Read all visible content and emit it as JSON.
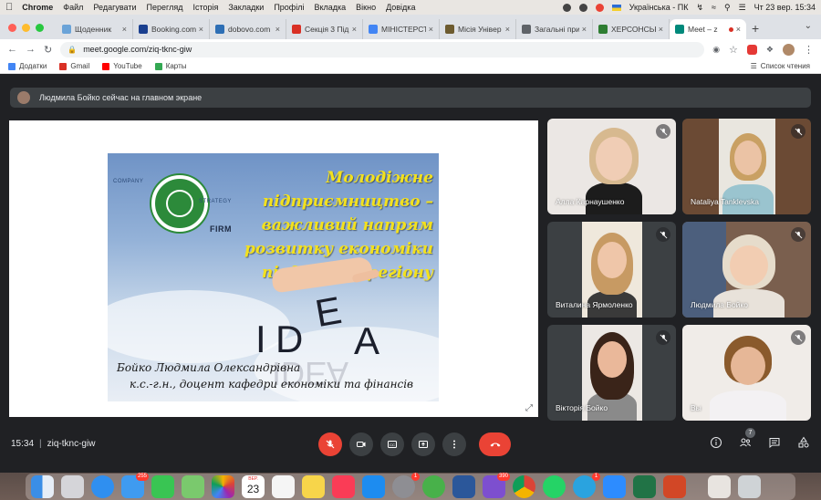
{
  "menubar": {
    "app": "Chrome",
    "menus": [
      "Файл",
      "Редагувати",
      "Перегляд",
      "Історія",
      "Закладки",
      "Профілі",
      "Вкладка",
      "Вікно",
      "Довідка"
    ],
    "keyboard_layout": "Українська - ПК",
    "datetime": "Чт 23 вер.  15:34"
  },
  "tabs": [
    {
      "title": "Щоденник",
      "color": "#6aa3d8"
    },
    {
      "title": "Booking.com",
      "color": "#1a3f8f"
    },
    {
      "title": "dobovo.com",
      "color": "#2e6fb5"
    },
    {
      "title": "Секція 3 Під",
      "color": "#d93025"
    },
    {
      "title": "МІНІСТЕРСТ",
      "color": "#4285f4"
    },
    {
      "title": "Місія Універ",
      "color": "#6d5b2f"
    },
    {
      "title": "Загальні при",
      "color": "#5f6368"
    },
    {
      "title": "ХЕРСОНСЬК",
      "color": "#2e7d32"
    },
    {
      "title": "Meet – z",
      "color": "#00897b"
    }
  ],
  "address": {
    "url": "meet.google.com/ziq-tknc-giw"
  },
  "bookmarks": {
    "items": [
      {
        "label": "Додатки",
        "color": "#4285f4"
      },
      {
        "label": "Gmail",
        "color": "#d93025"
      },
      {
        "label": "YouTube",
        "color": "#ff0000"
      },
      {
        "label": "Карты",
        "color": "#34a853"
      }
    ],
    "reading_list": "Список чтения"
  },
  "meet": {
    "presenting_text": "Людмила Бойко сейчас на главном экране",
    "slide": {
      "headline": "Молодіжне підприємництво – важливий напрям розвитку економіки південного регіону",
      "word_idea": "IDEA",
      "author": "Бойко Людмила Олександрівна",
      "author_sub": "к.с.-г.н., доцент кафедри економіки та фінансів"
    },
    "participants": [
      {
        "name": "Алла Карнаушенко"
      },
      {
        "name": "Nataliya Tanklevska"
      },
      {
        "name": "Виталина Ярмоленко"
      },
      {
        "name": "Людмила Бойко"
      },
      {
        "name": "Вікторія Бойко"
      },
      {
        "name": "Вы"
      }
    ],
    "time": "15:34",
    "meeting_code": "ziq-tknc-giw",
    "participant_count": "7"
  },
  "dock": {
    "mail_badge": "255",
    "calendar_month": "ВЕР.",
    "calendar_day": "23",
    "settings_badge": "1",
    "viber_badge": "390",
    "telegram_badge": "1"
  },
  "colors": {
    "meet_bg": "#202124",
    "tile_bg": "#3c4043",
    "danger": "#ea4335",
    "slide_title": "#f3e11e"
  }
}
